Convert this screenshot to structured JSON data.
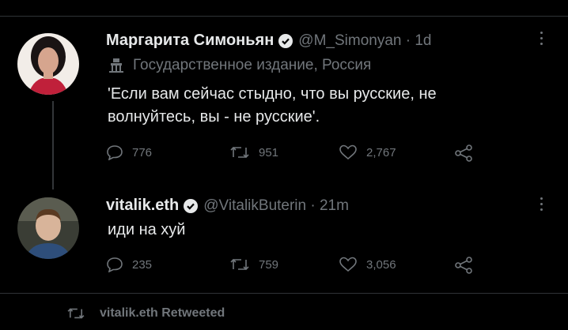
{
  "tweet1": {
    "name": "Маргарита Симоньян",
    "handle": "@M_Simonyan",
    "time": "1d",
    "label": "Государственное издание, Россия",
    "text_line1": "'Если вам сейчас стыдно, что вы русские, не",
    "text_line2": "волнуйтесь, вы - не русские'.",
    "replies": "776",
    "retweets": "951",
    "likes": "2,767"
  },
  "tweet2": {
    "name": "vitalik.eth",
    "handle": "@VitalikButerin",
    "time": "21m",
    "text": "иди на хуй",
    "replies": "235",
    "retweets": "759",
    "likes": "3,056"
  },
  "footer": {
    "retweet_label": "vitalik.eth Retweeted"
  },
  "colors": {
    "background": "#000000",
    "text": "#e7e9ea",
    "muted": "#71767b",
    "verified": "#1d9bf0"
  },
  "icons": [
    "verified-badge-icon",
    "building-icon",
    "reply-icon",
    "retweet-icon",
    "like-icon",
    "share-icon",
    "more-icon"
  ]
}
